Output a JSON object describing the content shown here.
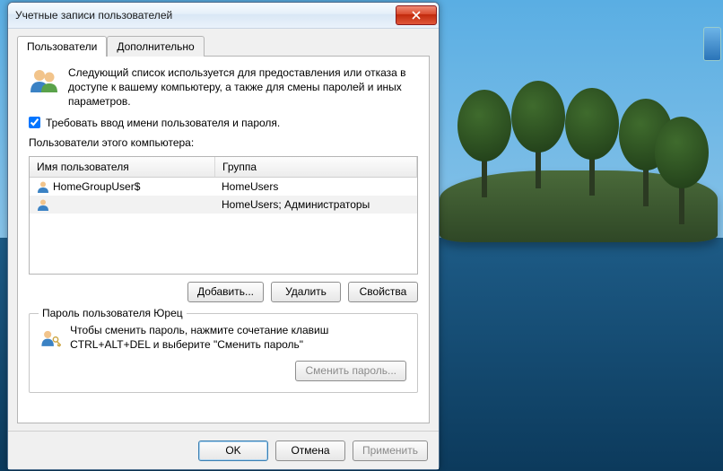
{
  "window": {
    "title": "Учетные записи пользователей"
  },
  "tabs": {
    "users": "Пользователи",
    "advanced": "Дополнительно"
  },
  "intro_text": "Следующий список используется для предоставления или отказа в доступе к вашему компьютеру, а также для смены паролей и иных параметров.",
  "require_password_label": "Требовать ввод имени пользователя и пароля.",
  "list_label": "Пользователи этого компьютера:",
  "columns": {
    "name": "Имя пользователя",
    "group": "Группа"
  },
  "rows": [
    {
      "name": "HomeGroupUser$",
      "group": "HomeUsers",
      "selected": false
    },
    {
      "name": "",
      "group": "HomeUsers; Администраторы",
      "selected": true
    }
  ],
  "buttons": {
    "add": "Добавить...",
    "delete": "Удалить",
    "properties": "Свойства",
    "change_password": "Сменить пароль...",
    "ok": "OK",
    "cancel": "Отмена",
    "apply": "Применить"
  },
  "password_group": {
    "legend": "Пароль пользователя Юрец",
    "text": "Чтобы сменить пароль, нажмите сочетание клавиш CTRL+ALT+DEL и выберите \"Сменить пароль\""
  }
}
